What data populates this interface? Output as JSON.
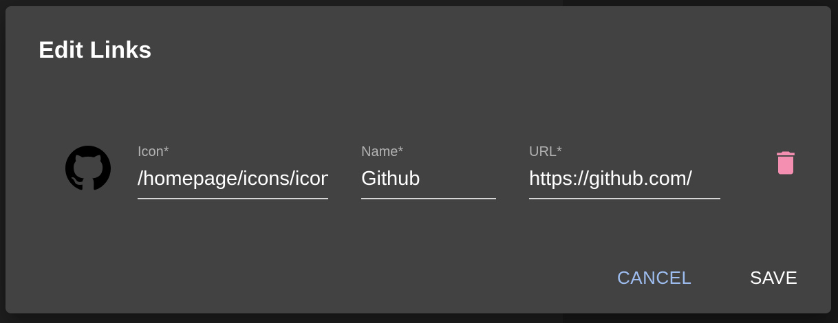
{
  "dialog": {
    "title": "Edit Links"
  },
  "link": {
    "icon_name": "github-icon",
    "icon_label": "Icon*",
    "icon_value": "/homepage/icons/icon.svg",
    "name_label": "Name*",
    "name_value": "Github",
    "url_label": "URL*",
    "url_value": "https://github.com/",
    "delete_icon_name": "trash-icon",
    "delete_color": "#f48fb1"
  },
  "actions": {
    "cancel_label": "CANCEL",
    "save_label": "SAVE"
  },
  "colors": {
    "dialog_bg": "#424242",
    "accent": "#9ebdf0"
  }
}
